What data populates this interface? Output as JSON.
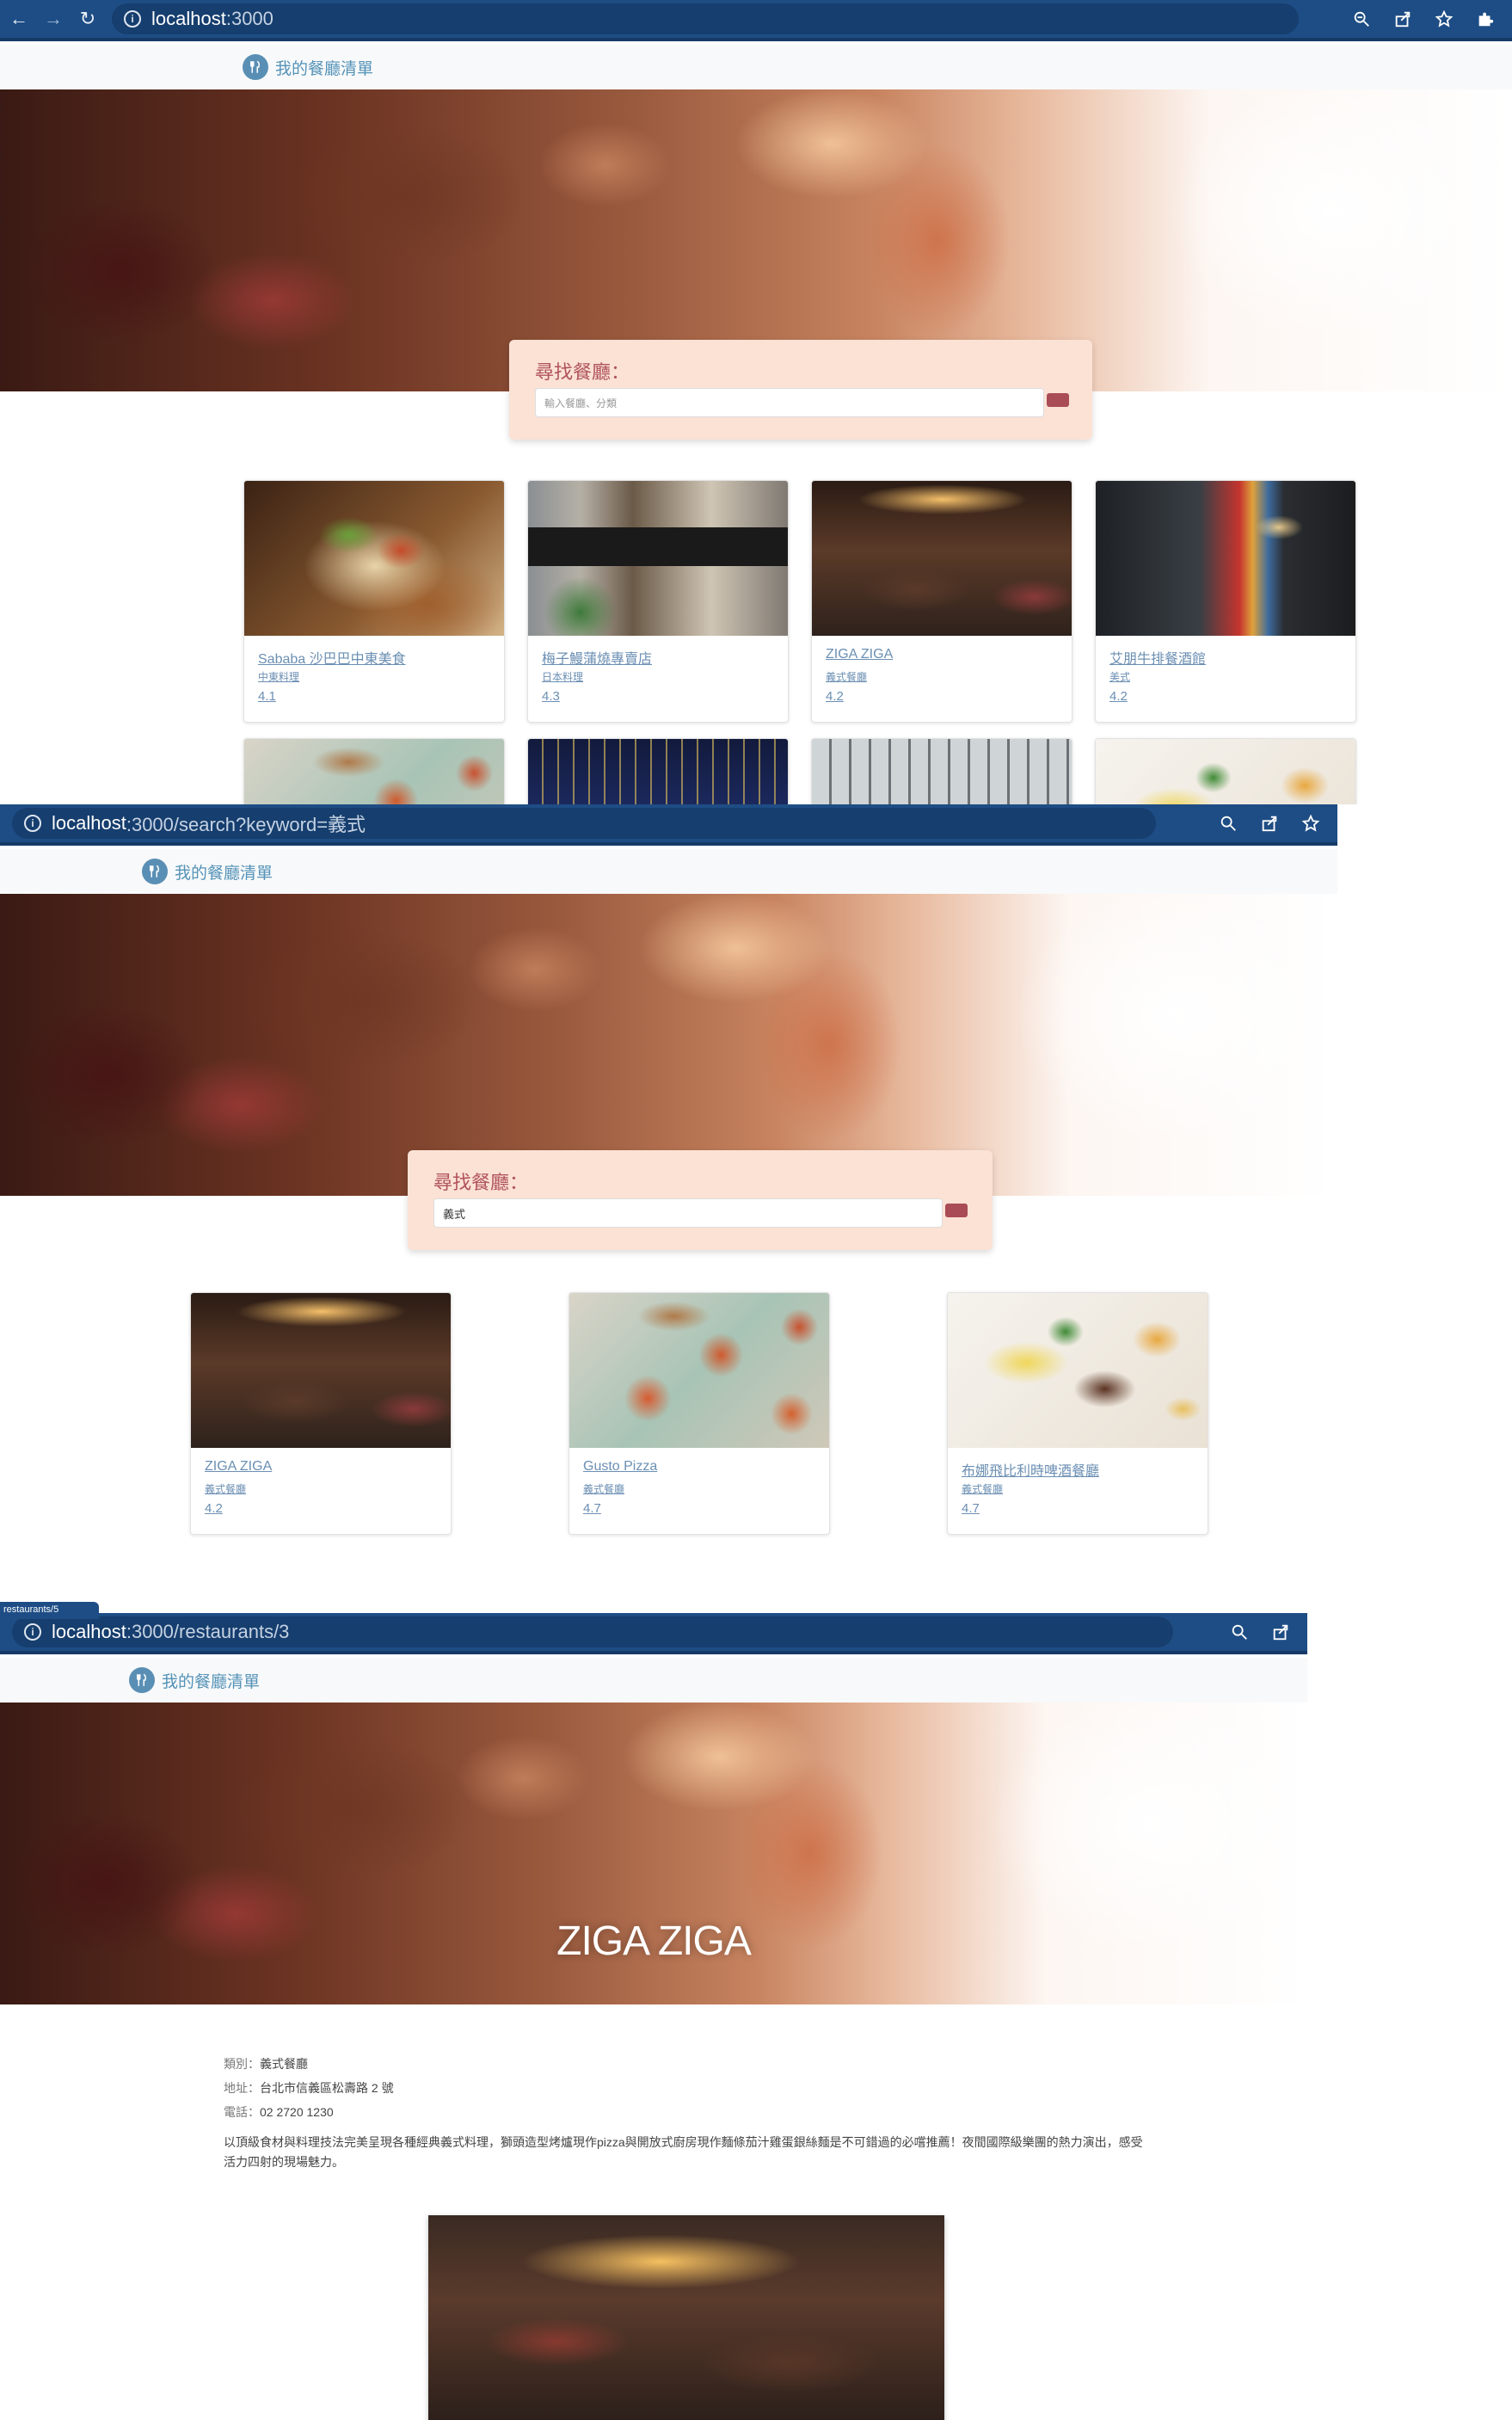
{
  "brand_label": "我的餐廳清單",
  "search_title": "尋找餐廳：",
  "screens": [
    {
      "host": "localhost",
      "path": ":3000",
      "search_placeholder": "輸入餐廳、分類",
      "restaurants": [
        {
          "name": "Sababa 沙巴巴中東美食",
          "category": "中東料理",
          "rating": "4.1"
        },
        {
          "name": "梅子鰻蒲燒專賣店",
          "category": "日本料理",
          "rating": "4.3"
        },
        {
          "name": "ZIGA ZIGA",
          "category": "義式餐廳",
          "rating": "4.2"
        },
        {
          "name": "艾朋牛排餐酒館",
          "category": "美式",
          "rating": "4.2"
        }
      ]
    },
    {
      "host": "localhost",
      "path": ":3000/search?keyword=義式",
      "search_value": "義式",
      "restaurants": [
        {
          "name": "ZIGA ZIGA",
          "category": "義式餐廳",
          "rating": "4.2"
        },
        {
          "name": "Gusto Pizza",
          "category": "義式餐廳",
          "rating": "4.7"
        },
        {
          "name": "布娜飛比利時啤酒餐廳",
          "category": "義式餐廳",
          "rating": "4.7"
        }
      ]
    },
    {
      "host": "localhost",
      "path": ":3000/restaurants/3",
      "restaurant_name": "ZIGA ZIGA",
      "category_label": "類別：",
      "category": "義式餐廳",
      "address_label": "地址：",
      "address": "台北市信義區松壽路 2 號",
      "phone_label": "電話：",
      "phone": "02 2720 1230",
      "description": "以頂級食材與料理技法完美呈現各種經典義式料理，獅頭造型烤爐現作pizza與開放式廚房現作麵條茄汁雞蛋銀絲麵是不可錯過的必嚐推薦！夜間國際級樂團的熱力演出，感受活力四射的現場魅力。"
    }
  ],
  "hover_tooltip": "restaurants/5",
  "icons": {
    "back": "back-arrow-icon",
    "forward": "forward-arrow-icon",
    "reload": "reload-icon",
    "info": "site-info-icon",
    "zoom": "zoom-icon",
    "share": "share-icon",
    "bookmark": "bookmark-star-icon",
    "extensions": "puzzle-extension-icon",
    "brand": "utensils-icon"
  },
  "colors": {
    "browser_bar": "#1e4d85",
    "brand_blue": "#5593b8",
    "search_panel": "#fbe2d5",
    "search_title": "#b0535a",
    "search_button": "#a94c55",
    "link": "#6b8fb3"
  }
}
